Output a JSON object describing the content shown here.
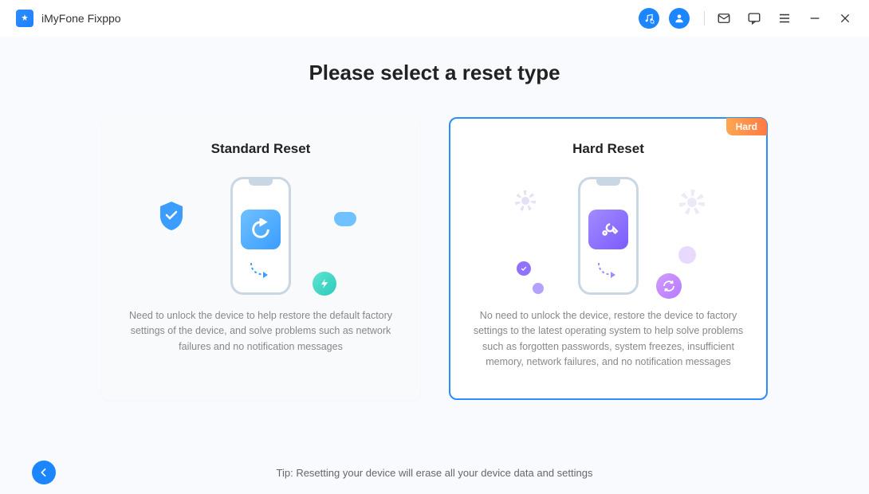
{
  "app": {
    "name": "iMyFone Fixppo"
  },
  "page": {
    "title": "Please select a reset type"
  },
  "cards": {
    "standard": {
      "title": "Standard Reset",
      "desc": "Need to unlock the device to help restore the default factory settings of the device, and solve problems such as network failures and no notification messages"
    },
    "hard": {
      "title": "Hard Reset",
      "badge": "Hard",
      "desc": "No need to unlock the device, restore the device to factory settings to the latest operating system to help solve problems such as forgotten passwords, system freezes, insufficient memory, network failures, and no notification messages"
    }
  },
  "footer": {
    "tip": "Tip: Resetting your device will erase all your device data and settings"
  }
}
